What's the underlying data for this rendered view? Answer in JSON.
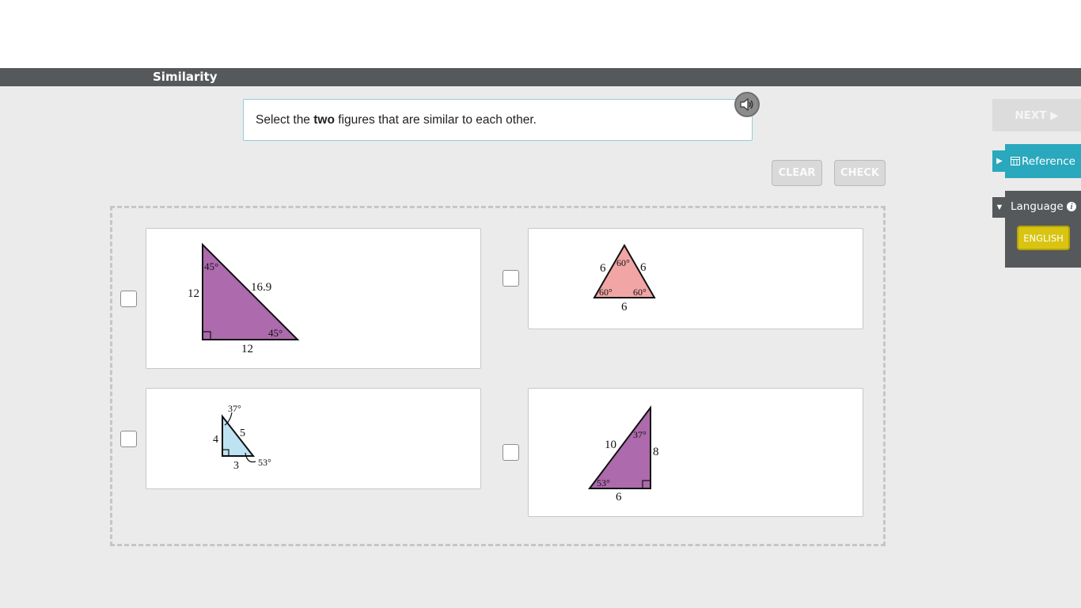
{
  "header": {
    "title": "Similarity"
  },
  "prompt": {
    "before": "Select the ",
    "emphasis": "two",
    "after": " figures that are similar to each other."
  },
  "toolbar": {
    "clear_label": "CLEAR",
    "check_label": "CHECK"
  },
  "side": {
    "next_label": "NEXT ▶",
    "reference_label": "Reference",
    "language_label": "Language",
    "language_value": "ENGLISH"
  },
  "figures": {
    "a": {
      "angle_top": "45°",
      "angle_right": "45°",
      "side_left": "12",
      "side_hyp": "16.9",
      "side_bottom": "12",
      "fill": "#ad6aad"
    },
    "b": {
      "angle_top": "60°",
      "angle_left": "60°",
      "angle_right": "60°",
      "side_left": "6",
      "side_right": "6",
      "side_bottom": "6",
      "fill": "#f2a5a5"
    },
    "c": {
      "angle_top": "37°",
      "angle_right": "53°",
      "side_left": "4",
      "side_hyp": "5",
      "side_bottom": "3",
      "fill": "#bde3f3"
    },
    "d": {
      "angle_top": "37°",
      "angle_left": "53°",
      "side_hyp": "10",
      "side_right": "8",
      "side_bottom": "6",
      "fill": "#ad6aad"
    }
  },
  "colors": {
    "title_bar": "#55595b",
    "accent": "#2aa8bd",
    "language_button": "#d8c411"
  }
}
